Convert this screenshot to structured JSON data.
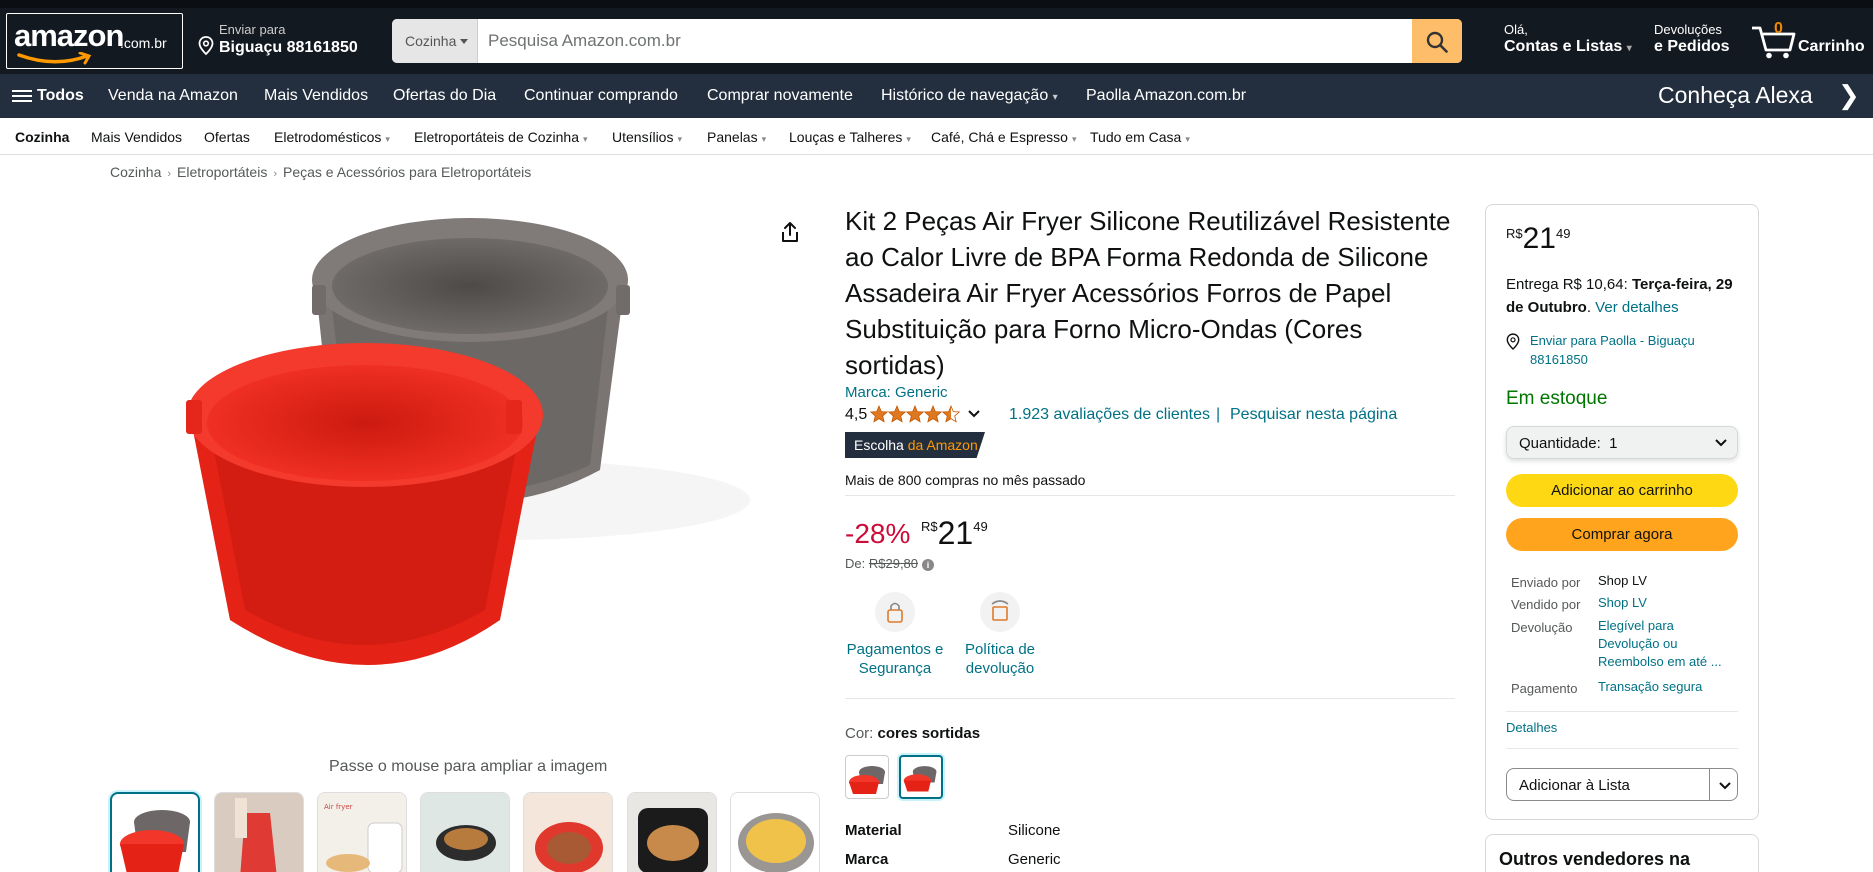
{
  "header": {
    "logo_text": "amazon",
    "logo_suffix": ".com.br",
    "deliver_line1": "Enviar para",
    "deliver_line2": "Biguaçu 88161850",
    "search_category": "Cozinha",
    "search_placeholder": "Pesquisa Amazon.com.br",
    "account_line1": "Olá,",
    "account_line2": "Contas e Listas",
    "returns_line1": "Devoluções",
    "returns_line2": "e Pedidos",
    "cart_count": "0",
    "cart_label": "Carrinho"
  },
  "nav": {
    "all_label": "Todos",
    "items": [
      "Venda na Amazon",
      "Mais Vendidos",
      "Ofertas do Dia",
      "Continuar comprando",
      "Comprar novamente",
      "Histórico de navegação",
      "Paolla Amazon.com.br"
    ],
    "promo": "Conheça Alexa"
  },
  "subnav": {
    "items": [
      "Cozinha",
      "Mais Vendidos",
      "Ofertas",
      "Eletrodomésticos",
      "Eletroportáteis de Cozinha",
      "Utensílios",
      "Panelas",
      "Louças e Talheres",
      "Café, Chá e Espresso",
      "Tudo em Casa"
    ]
  },
  "breadcrumb": [
    "Cozinha",
    "Eletroportáteis",
    "Peças e Acessórios para Eletroportáteis"
  ],
  "gallery": {
    "hover_hint": "Passe o mouse para ampliar a imagem"
  },
  "product": {
    "title": "Kit 2 Peças Air Fryer Silicone Reutilizável Resistente ao Calor Livre de BPA Forma Redonda de Silicone Assadeira Air Fryer Acessórios Forros de Papel Substituição para Forno Micro-Ondas (Cores sortidas)",
    "brand": "Marca: Generic",
    "rating_value": "4,5",
    "rating_stars": 4.5,
    "reviews": "1.923 avaliações de clientes",
    "separator": "|",
    "search_page": "Pesquisar nesta página",
    "choice_a": "Escolha",
    "choice_b": "da Amazon",
    "bought": "Mais de 800 compras no mês passado",
    "discount": "-28%",
    "price_currency": "R$",
    "price_whole": "21",
    "price_fraction": "49",
    "list_price_label": "De:",
    "list_price": "R$29,80",
    "features": [
      "Pagamentos e Segurança",
      "Política de devolução"
    ],
    "color_label": "Cor:",
    "color_value": "cores sortidas",
    "specs": [
      {
        "key": "Material",
        "value": "Silicone"
      },
      {
        "key": "Marca",
        "value": "Generic"
      }
    ]
  },
  "buybox": {
    "currency": "R$",
    "whole": "21",
    "fraction": "49",
    "delivery_prefix": "Entrega R$ 10,64:",
    "delivery_date": "Terça-feira, 29 de Outubro",
    "delivery_link": "Ver detalhes",
    "ship_to": "Enviar para Paolla - Biguaçu 88161850",
    "stock": "Em estoque",
    "quantity": "Quantidade:  1",
    "add_to_cart": "Adicionar ao carrinho",
    "buy_now": "Comprar agora",
    "info": [
      {
        "key": "Enviado por",
        "value": "Shop LV"
      },
      {
        "key": "Vendido por",
        "value": "Shop LV"
      },
      {
        "key": "Devolução",
        "value": "Elegível para Devolução ou Reembolso em até ..."
      },
      {
        "key": "Pagamento",
        "value": "Transação segura"
      }
    ],
    "details": "Detalhes",
    "add_to_list": "Adicionar à Lista",
    "other_sellers": "Outros vendedores na"
  },
  "colors": {
    "link": "#007185",
    "nav_bg": "#232f3e",
    "header_bg": "#131921",
    "add_to_cart": "#ffd814",
    "buy_now": "#ffa41c",
    "discount": "#cc0c39",
    "in_stock": "#007600"
  }
}
